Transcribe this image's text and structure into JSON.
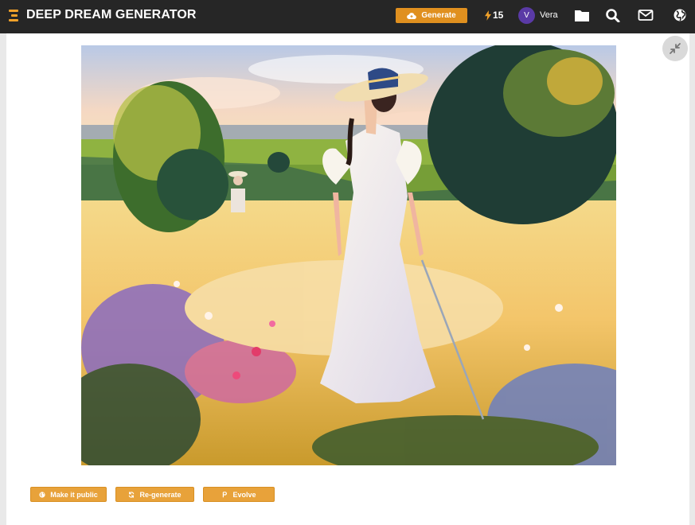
{
  "header": {
    "brand": "DEEP DREAM GENERATOR",
    "generate_label": "Generate",
    "energy": "15",
    "user": {
      "initial": "V",
      "name": "Vera"
    },
    "icons": [
      "menu-icon",
      "folder-icon",
      "search-icon",
      "mail-icon",
      "globe-icon"
    ]
  },
  "image": {
    "alt": "Impressionist painting of a woman in a white dress and straw hat walking through a sunlit flower meadow"
  },
  "actions": {
    "make_public": "Make it public",
    "regenerate": "Re-generate",
    "evolve": "Evolve"
  },
  "colors": {
    "topbar": "#262626",
    "accent": "#e0901f",
    "button": "#e8a23a",
    "avatar": "#5a3aa6"
  }
}
